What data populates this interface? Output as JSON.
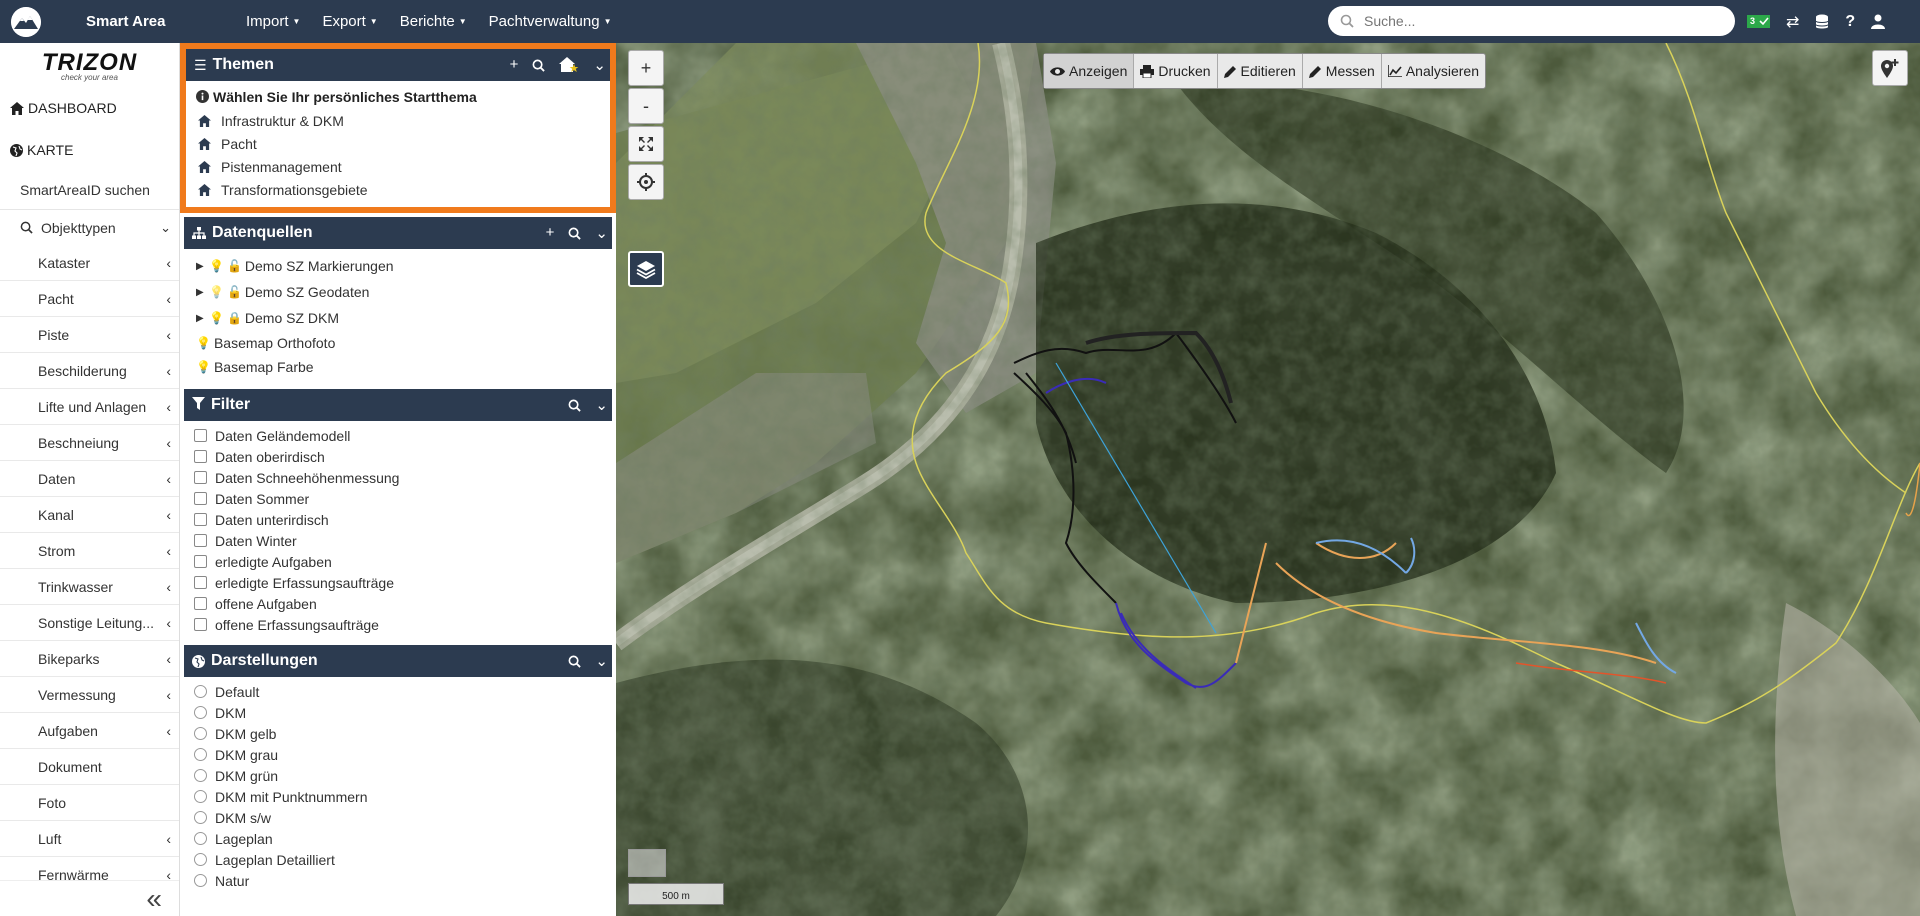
{
  "app": {
    "name": "Smart Area"
  },
  "menu": [
    {
      "label": "Import"
    },
    {
      "label": "Export"
    },
    {
      "label": "Berichte"
    },
    {
      "label": "Pachtverwaltung"
    }
  ],
  "search": {
    "placeholder": "Suche..."
  },
  "topbar_badge": "3",
  "brand": {
    "name": "TRIZON",
    "tagline": "check your area"
  },
  "sidebar": {
    "dashboard": "DASHBOARD",
    "karte": "KARTE",
    "smartarea_search": "SmartAreaID suchen",
    "objekttypen": "Objekttypen",
    "items": [
      {
        "label": "Kataster",
        "has_children": true
      },
      {
        "label": "Pacht",
        "has_children": true
      },
      {
        "label": "Piste",
        "has_children": true
      },
      {
        "label": "Beschilderung",
        "has_children": true
      },
      {
        "label": "Lifte und Anlagen",
        "has_children": true
      },
      {
        "label": "Beschneiung",
        "has_children": true
      },
      {
        "label": "Daten",
        "has_children": true
      },
      {
        "label": "Kanal",
        "has_children": true
      },
      {
        "label": "Strom",
        "has_children": true
      },
      {
        "label": "Trinkwasser",
        "has_children": true
      },
      {
        "label": "Sonstige Leitung...",
        "has_children": true
      },
      {
        "label": "Bikeparks",
        "has_children": true
      },
      {
        "label": "Vermessung",
        "has_children": true
      },
      {
        "label": "Aufgaben",
        "has_children": true
      },
      {
        "label": "Dokument",
        "has_children": false
      },
      {
        "label": "Foto",
        "has_children": false
      },
      {
        "label": "Luft",
        "has_children": true
      },
      {
        "label": "Fernwärme",
        "has_children": true
      }
    ]
  },
  "themen": {
    "title": "Themen",
    "intro": "Wählen Sie Ihr persönliches Startthema",
    "items": [
      "Infrastruktur & DKM",
      "Pacht",
      "Pistenmanagement",
      "Transformationsgebiete"
    ]
  },
  "datenquellen": {
    "title": "Datenquellen",
    "items": [
      {
        "label": "Demo SZ Markierungen"
      },
      {
        "label": "Demo SZ Geodaten"
      },
      {
        "label": "Demo SZ DKM"
      },
      {
        "label": "Basemap Orthofoto"
      },
      {
        "label": "Basemap Farbe"
      }
    ]
  },
  "filter": {
    "title": "Filter",
    "items": [
      "Daten Geländemodell",
      "Daten oberirdisch",
      "Daten Schneehöhenmessung",
      "Daten Sommer",
      "Daten unterirdisch",
      "Daten Winter",
      "erledigte Aufgaben",
      "erledigte Erfassungsaufträge",
      "offene Aufgaben",
      "offene Erfassungsaufträge"
    ]
  },
  "darstellungen": {
    "title": "Darstellungen",
    "items": [
      "Default",
      "DKM",
      "DKM gelb",
      "DKM grau",
      "DKM grün",
      "DKM mit Punktnummern",
      "DKM s/w",
      "Lageplan",
      "Lageplan Detailliert",
      "Natur"
    ]
  },
  "map": {
    "zoom_in": "+",
    "zoom_out": "-",
    "toolbar": [
      {
        "label": "Anzeigen",
        "icon": "eye-icon",
        "active": true
      },
      {
        "label": "Drucken",
        "icon": "print-icon",
        "active": false
      },
      {
        "label": "Editieren",
        "icon": "pencil-icon",
        "active": false
      },
      {
        "label": "Messen",
        "icon": "ruler-icon",
        "active": false
      },
      {
        "label": "Analysieren",
        "icon": "chart-icon",
        "active": false
      }
    ],
    "scale": "500 m"
  },
  "colors": {
    "nav": "#2c3b50",
    "accent_orange": "#f07a1c",
    "bulb_yellow": "#e7c11b",
    "badge_green": "#2ca84a"
  }
}
